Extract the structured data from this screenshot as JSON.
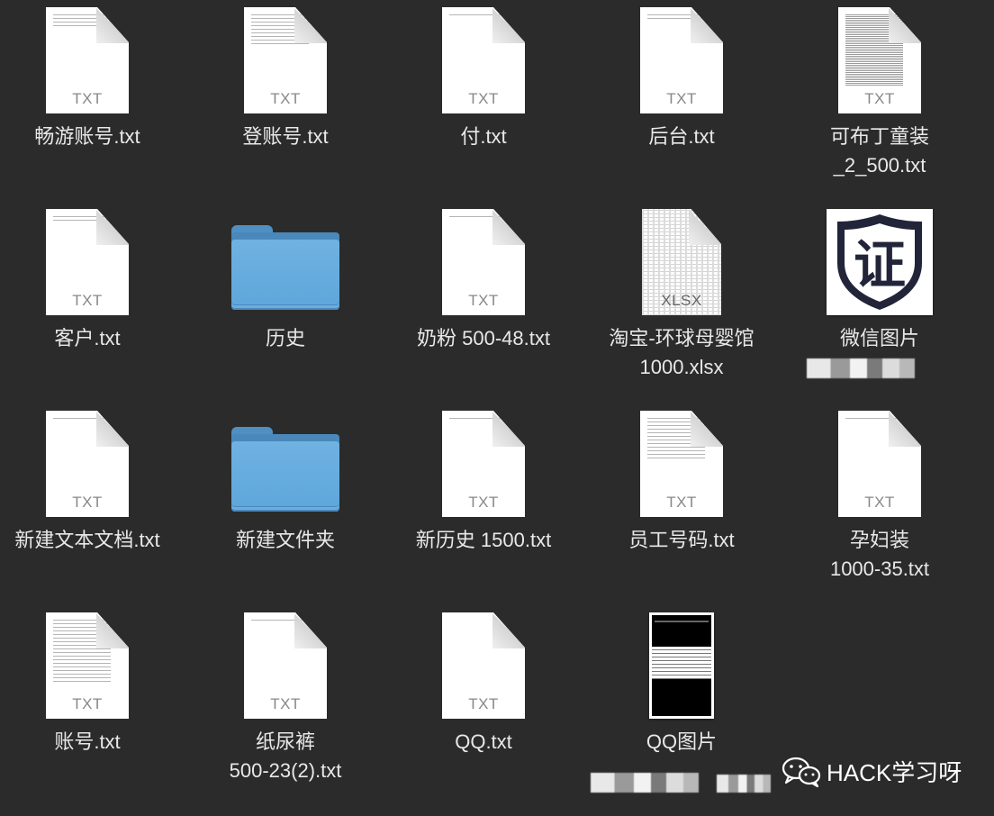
{
  "items": [
    {
      "label": "畅游账号.txt",
      "icon": "txt-document-icon",
      "ext": "TXT"
    },
    {
      "label": "登账号.txt",
      "icon": "txt-document-icon",
      "ext": "TXT"
    },
    {
      "label": "付.txt",
      "icon": "txt-document-icon",
      "ext": "TXT"
    },
    {
      "label": "后台.txt",
      "icon": "txt-document-icon",
      "ext": "TXT"
    },
    {
      "label": "可布丁童装\n_2_500.txt",
      "icon": "txt-document-icon",
      "ext": "TXT"
    },
    {
      "label": "客户.txt",
      "icon": "txt-document-icon",
      "ext": "TXT"
    },
    {
      "label": "历史",
      "icon": "folder-icon"
    },
    {
      "label": "奶粉 500-48.txt",
      "icon": "txt-document-icon",
      "ext": "TXT"
    },
    {
      "label": "淘宝-环球母婴馆\n1000.xlsx",
      "icon": "xlsx-document-icon",
      "ext": "XLSX"
    },
    {
      "label": "微信图片\n_2",
      "icon": "image-thumbnail-icon",
      "badge_char": "证"
    },
    {
      "label": "新建文本文档.txt",
      "icon": "txt-document-icon",
      "ext": "TXT"
    },
    {
      "label": "新建文件夹",
      "icon": "folder-icon"
    },
    {
      "label": "新历史 1500.txt",
      "icon": "txt-document-icon",
      "ext": "TXT"
    },
    {
      "label": "员工号码.txt",
      "icon": "txt-document-icon",
      "ext": "TXT"
    },
    {
      "label": "孕妇装\n1000-35.txt",
      "icon": "txt-document-icon",
      "ext": "TXT"
    },
    {
      "label": "账号.txt",
      "icon": "txt-document-icon",
      "ext": "TXT"
    },
    {
      "label": "纸尿裤\n500-23(2).txt",
      "icon": "txt-document-icon",
      "ext": "TXT"
    },
    {
      "label": "QQ.txt",
      "icon": "txt-document-icon",
      "ext": "TXT"
    },
    {
      "label": "QQ图片",
      "icon": "image-thumbnail-icon"
    }
  ],
  "watermark": {
    "text": "HACK学习呀",
    "icon": "wechat-icon"
  },
  "colors": {
    "background": "#2b2b2b",
    "label": "#e8e8e8",
    "folder": "#5ea6da",
    "document": "#ffffff",
    "ext": "#888888"
  }
}
